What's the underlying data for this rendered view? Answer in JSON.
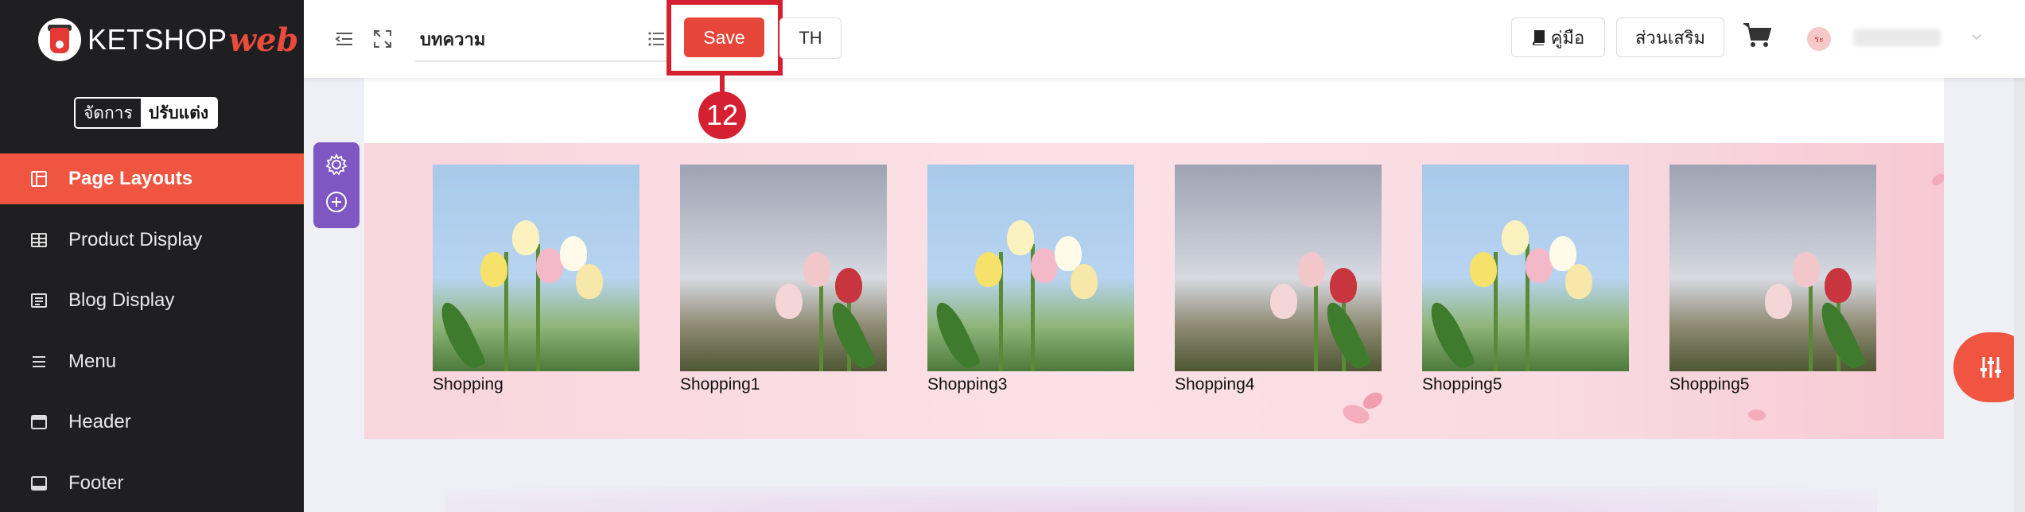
{
  "logo": {
    "text": "KETSHOP",
    "accent": "web"
  },
  "mode": {
    "manage": "จัดการ",
    "design": "ปรับแต่ง"
  },
  "sidebar": {
    "items": [
      {
        "label": "Page Layouts",
        "icon": "layout-icon",
        "active": true
      },
      {
        "label": "Product Display",
        "icon": "grid-icon",
        "active": false
      },
      {
        "label": "Blog Display",
        "icon": "list-card-icon",
        "active": false
      },
      {
        "label": "Menu",
        "icon": "hamburger-icon",
        "active": false
      },
      {
        "label": "Header",
        "icon": "window-header-icon",
        "active": false
      },
      {
        "label": "Footer",
        "icon": "window-footer-icon",
        "active": false
      }
    ]
  },
  "toolbar": {
    "title_value": "บทความ",
    "save_label": "Save",
    "lang_label": "TH",
    "guide_label": "คู่มือ",
    "addon_label": "ส่วนเสริม",
    "avatar_text": "ระ",
    "callout_number": "12"
  },
  "gallery": {
    "items": [
      {
        "caption": "Shopping",
        "image": "tulip-bouquet-blue-sky"
      },
      {
        "caption": "Shopping1",
        "image": "tulips-cloudy-sky"
      },
      {
        "caption": "Shopping3",
        "image": "tulip-bouquet-blue-sky"
      },
      {
        "caption": "Shopping4",
        "image": "tulips-cloudy-sky"
      },
      {
        "caption": "Shopping5",
        "image": "tulip-bouquet-blue-sky"
      },
      {
        "caption": "Shopping5",
        "image": "tulips-cloudy-sky"
      }
    ]
  },
  "colors": {
    "accent": "#ef5541",
    "sidebar_bg": "#1f1f21",
    "save": "#e6463a",
    "highlight": "#d42030",
    "tool_purple": "#7e57c2"
  }
}
